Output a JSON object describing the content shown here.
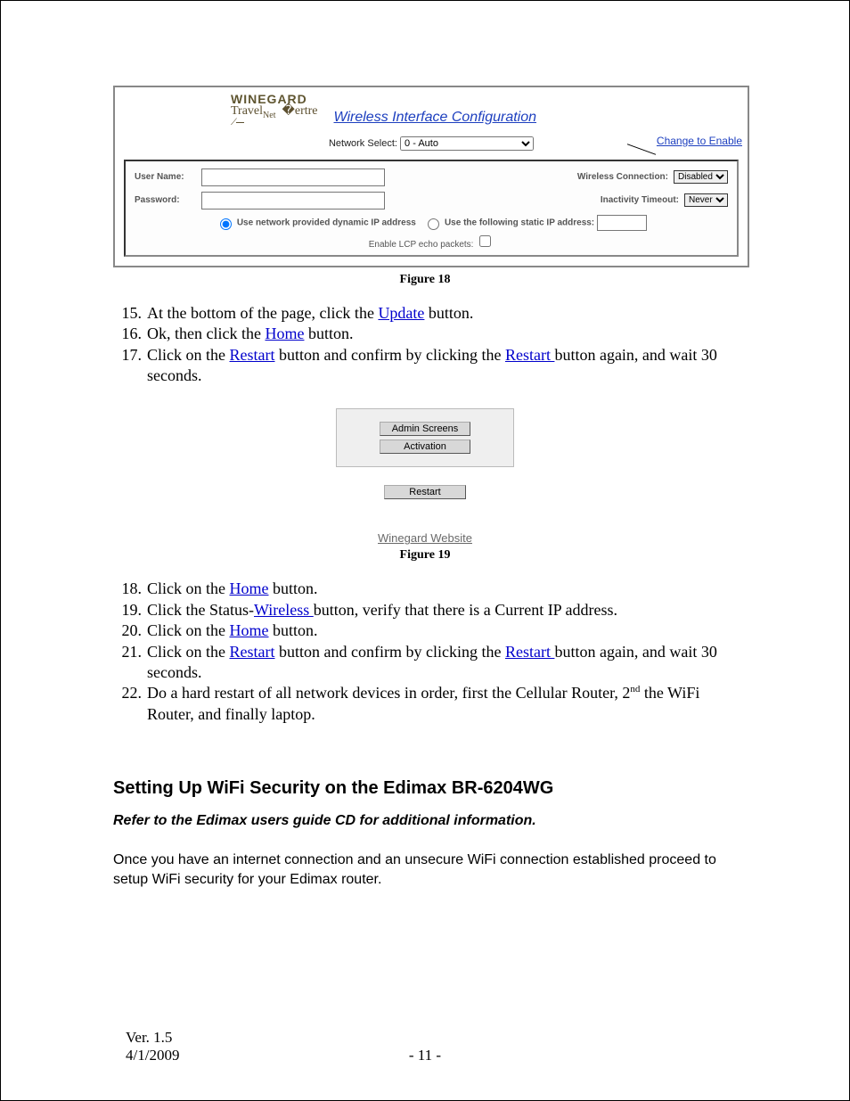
{
  "fig18": {
    "logo_top": "WINEGARD",
    "logo_sub_a": "Travel",
    "logo_sub_b": "Net",
    "title": "Wireless Interface Configuration",
    "network_select_label": "Network Select:",
    "network_select_value": "0 - Auto",
    "change_link": "Change to Enable",
    "user_label": "User Name:",
    "pass_label": "Password:",
    "wconn_label": "Wireless Connection:",
    "wconn_value": "Disabled",
    "itimeout_label": "Inactivity Timeout:",
    "itimeout_value": "Never",
    "radio_dyn": "Use network provided dynamic IP address",
    "radio_static": "Use the following static IP address:",
    "lcp_label": "Enable LCP echo packets:",
    "caption": "Figure 18"
  },
  "steps_a": {
    "s15_num": "15.",
    "s15_a": "At the bottom of the page, click the ",
    "s15_link": "Update",
    "s15_b": " button.",
    "s16_num": "16.",
    "s16_a": "Ok, then click the ",
    "s16_link": "Home",
    "s16_b": " button.",
    "s17_num": "17.",
    "s17_a": "Click on the ",
    "s17_link1": "Restart",
    "s17_b": " button and confirm by clicking the ",
    "s17_link2": "Restart ",
    "s17_c": "button again, and wait 30 seconds."
  },
  "fig19": {
    "btn_admin": "Admin Screens",
    "btn_activation": "Activation",
    "btn_restart": "Restart",
    "site_link": "Winegard Website",
    "caption": "Figure 19"
  },
  "steps_b": {
    "s18_num": "18.",
    "s18_a": "Click on the ",
    "s18_link": "Home",
    "s18_b": " button.",
    "s19_num": "19.",
    "s19_a": "Click the Status-",
    "s19_link": "Wireless ",
    "s19_b": "button, verify that there is a Current IP address.",
    "s20_num": "20.",
    "s20_a": " Click on the ",
    "s20_link": "Home",
    "s20_b": " button.",
    "s21_num": "21.",
    "s21_a": "Click on the ",
    "s21_link1": "Restart",
    "s21_b": " button and confirm by clicking the ",
    "s21_link2": "Restart ",
    "s21_c": "button again, and wait 30 seconds.",
    "s22_num": "22.",
    "s22_a": " Do a hard restart of all network devices in order, first the Cellular Router, 2",
    "s22_sup": "nd",
    "s22_b": " the WiFi Router, and finally laptop."
  },
  "section": {
    "heading": "Setting Up WiFi Security on the Edimax BR-6204WG",
    "subnote": "Refer to the Edimax users guide CD for additional information.",
    "para": "Once you have an internet connection and an unsecure WiFi connection established proceed to setup WiFi security for your Edimax router."
  },
  "footer": {
    "version": "Ver. 1.5",
    "date": "4/1/2009",
    "page": "- 11 -"
  }
}
